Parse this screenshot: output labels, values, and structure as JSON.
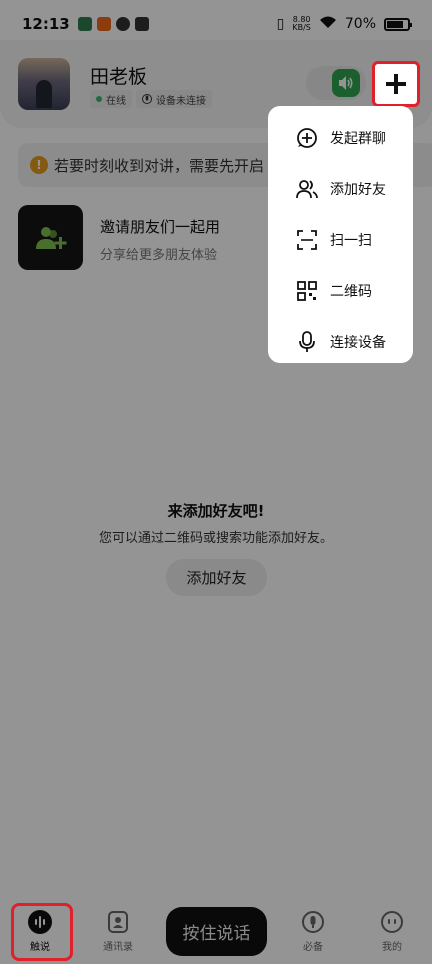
{
  "status_bar": {
    "time": "12:13",
    "network_speed": "8.80",
    "network_unit": "KB/S",
    "battery": "70%",
    "battery_level": 0.7
  },
  "profile": {
    "name": "田老板",
    "presence": "在线",
    "device_status": "设备未连接"
  },
  "notice": {
    "text": "若要时刻收到对讲，需要先开启"
  },
  "invite": {
    "title": "邀请朋友们一起用",
    "subtitle": "分享给更多朋友体验"
  },
  "empty_state": {
    "title": "来添加好友吧!",
    "description": "您可以通过二维码或搜索功能添加好友。",
    "button": "添加好友"
  },
  "menu": {
    "items": [
      {
        "label": "发起群聊",
        "icon": "plus-circle-icon"
      },
      {
        "label": "添加好友",
        "icon": "add-user-icon"
      },
      {
        "label": "扫一扫",
        "icon": "scan-icon"
      },
      {
        "label": "二维码",
        "icon": "qr-code-icon"
      },
      {
        "label": "连接设备",
        "icon": "microphone-icon"
      }
    ]
  },
  "bottom_nav": {
    "items": [
      {
        "label": "触说",
        "icon": "voice-wave-icon"
      },
      {
        "label": "通讯录",
        "icon": "contacts-icon"
      },
      {
        "label": "必备",
        "icon": "mic-badge-icon"
      },
      {
        "label": "我的",
        "icon": "profile-face-icon"
      }
    ],
    "ptt_label": "按住说话"
  },
  "colors": {
    "accent_green": "#2ea44f",
    "highlight_red": "#e0202b",
    "warning": "#e49b1c"
  }
}
